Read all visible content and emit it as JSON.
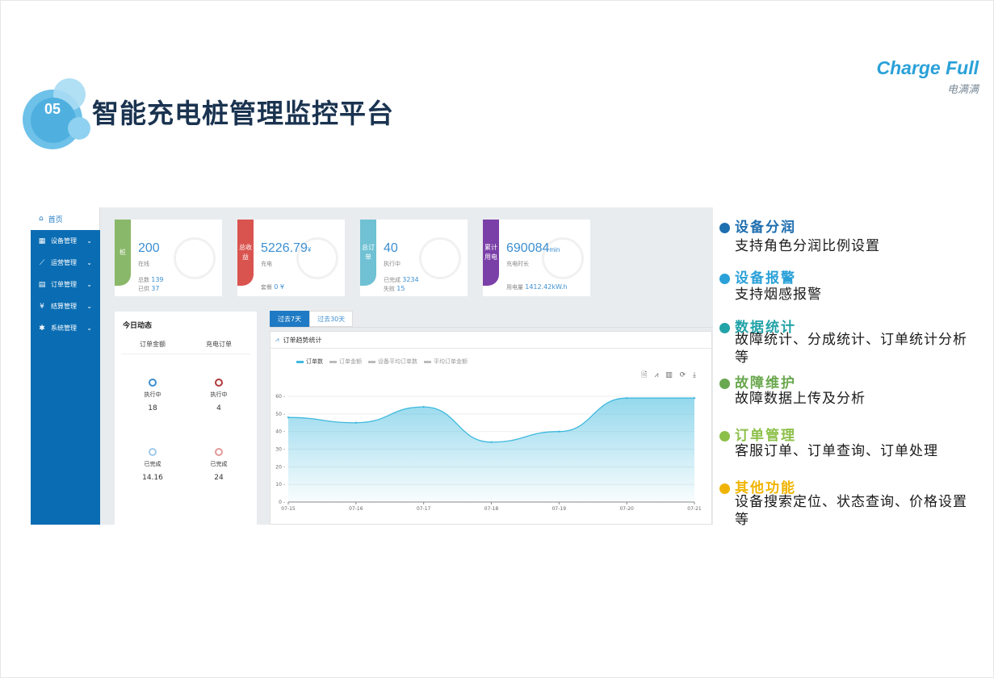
{
  "header": {
    "section_number": "05",
    "title": "智能充电桩管理监控平台",
    "brand_en": "Charge Full",
    "brand_cn": "电满满"
  },
  "sidebar": {
    "home": "首页",
    "items": [
      {
        "label": "设备管理",
        "icon": "grid-icon"
      },
      {
        "label": "运营管理",
        "icon": "chart-icon"
      },
      {
        "label": "订单管理",
        "icon": "document-icon"
      },
      {
        "label": "结算管理",
        "icon": "yen-icon"
      },
      {
        "label": "系统管理",
        "icon": "gear-icon"
      }
    ]
  },
  "cards": [
    {
      "tag": "桩",
      "value": "200",
      "unit": "",
      "sub": "在线",
      "foot1_label": "总数",
      "foot1_value": "139",
      "foot2_label": "已供",
      "foot2_value": "37",
      "color": "#8ab86a"
    },
    {
      "tag": "总收益",
      "value": "5226.79",
      "unit": "¥",
      "sub": "充电",
      "foot1_label": "套餐",
      "foot1_value": "0 ¥",
      "foot2_label": "",
      "foot2_value": "",
      "color": "#d9534f"
    },
    {
      "tag": "总订单",
      "value": "40",
      "unit": "",
      "sub": "执行中",
      "foot1_label": "已完成",
      "foot1_value": "3234",
      "foot2_label": "失败",
      "foot2_value": "15",
      "color": "#6fc1d3"
    },
    {
      "tag": "累计用电",
      "value": "690084",
      "unit": "min",
      "sub": "充电时长",
      "foot1_label": "用电量",
      "foot1_value": "1412.42kW.h",
      "foot2_label": "",
      "foot2_value": "",
      "color": "#7b3fa8"
    }
  ],
  "today": {
    "title": "今日动态",
    "col1": "订单金额",
    "col2": "充电订单",
    "stats": [
      {
        "label": "执行中",
        "value": "18"
      },
      {
        "label": "执行中",
        "value": "4"
      },
      {
        "label": "已完成",
        "value": "14.16"
      },
      {
        "label": "已完成",
        "value": "24"
      }
    ]
  },
  "tabs": [
    "过去7天",
    "过去30天"
  ],
  "chart_panel": {
    "title": "订单趋势统计",
    "legend": [
      "订单数",
      "订单金额",
      "设备平均订单数",
      "平均订单金额"
    ],
    "toolbox": "🗎 ⩘ ▥ ⟳ ⤓"
  },
  "chart_data": {
    "type": "area",
    "title": "订单趋势统计",
    "x": [
      "07-15",
      "07-16",
      "07-17",
      "07-18",
      "07-19",
      "07-20",
      "07-21"
    ],
    "series": [
      {
        "name": "订单数",
        "values": [
          48,
          45,
          54,
          34,
          40,
          59,
          59
        ]
      }
    ],
    "ylim": [
      0,
      60
    ],
    "yticks": [
      0,
      10,
      20,
      30,
      40,
      50,
      60
    ],
    "grid": true,
    "legend": "top-left",
    "color": "#3fb9de"
  },
  "features": [
    {
      "title": "设备分润",
      "desc": "支持角色分润比例设置",
      "color": "#1e6fb0"
    },
    {
      "title": "设备报警",
      "desc": "支持烟感报警",
      "color": "#2aa1d8"
    },
    {
      "title": "数据统计",
      "desc": "故障统计、分成统计、订单统计分析等",
      "color": "#22a3a8"
    },
    {
      "title": "故障维护",
      "desc": "故障数据上传及分析",
      "color": "#6aa84f"
    },
    {
      "title": "订单管理",
      "desc": "客服订单、订单查询、订单处理",
      "color": "#8dc04a"
    },
    {
      "title": "其他功能",
      "desc": "设备搜索定位、状态查询、价格设置等",
      "color": "#f0b400"
    }
  ]
}
